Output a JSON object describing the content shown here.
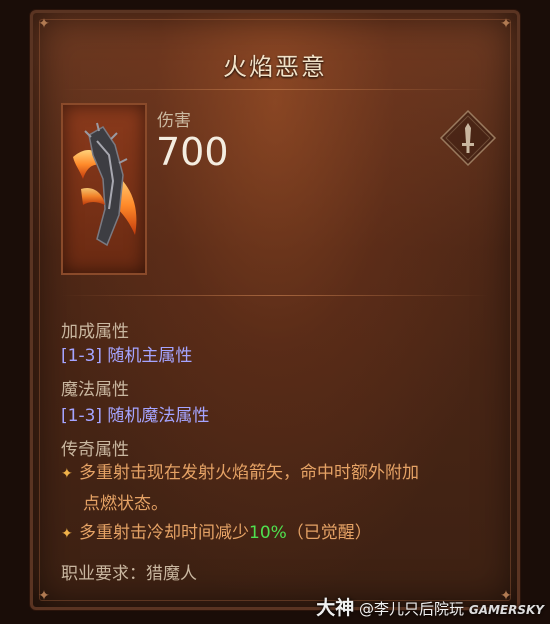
{
  "item": {
    "name": "火焰恶意",
    "damage_label": "伤害",
    "damage_value": "700"
  },
  "icons": {
    "item_image": "flame-crossbow-icon",
    "weapon_type": "sword-icon",
    "legendary_bullet": "star-diamond-icon"
  },
  "sections": {
    "bonus": {
      "title": "加成属性",
      "affix": "[1-3] 随机主属性"
    },
    "magic": {
      "title": "魔法属性",
      "affix": "[1-3] 随机魔法属性"
    },
    "legendary": {
      "title": "传奇属性",
      "line1_part1": "多重射击现在发射火焰箭矢，命中时额外附加",
      "line1_part2": "点燃状态。",
      "line2_pre": "多重射击冷却时间减少",
      "line2_value": "10%",
      "line2_post": "（已觉醒）"
    }
  },
  "requirement": "职业要求：猎魔人",
  "watermark": {
    "logo": "大神",
    "author": "@李儿只后院玩",
    "brand": "GAMERSKY"
  },
  "colors": {
    "magic_affix": "#a5a4ff",
    "legendary_text": "#e5a265",
    "highlight_value": "#4fe04f"
  }
}
